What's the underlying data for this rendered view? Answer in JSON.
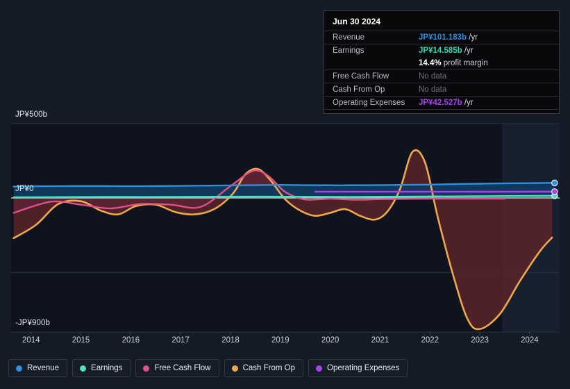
{
  "tooltip": {
    "date": "Jun 30 2024",
    "rows": [
      {
        "key": "Revenue",
        "amount": "JP¥101.183b",
        "unit": "/yr",
        "color": "#2d8fe0",
        "nodata": false
      },
      {
        "key": "Earnings",
        "amount": "JP¥14.585b",
        "unit": "/yr",
        "color": "#2fd6ae",
        "nodata": false
      },
      {
        "key": "",
        "amount": "14.4%",
        "unit": "profit margin",
        "color": "#ffffff",
        "nodata": false,
        "sub": true
      },
      {
        "key": "Free Cash Flow",
        "amount": "No data",
        "unit": "",
        "color": "#6e727a",
        "nodata": true
      },
      {
        "key": "Cash From Op",
        "amount": "No data",
        "unit": "",
        "color": "#6e727a",
        "nodata": true
      },
      {
        "key": "Operating Expenses",
        "amount": "JP¥42.527b",
        "unit": "/yr",
        "color": "#a93ff0",
        "nodata": false
      }
    ]
  },
  "legend": {
    "items": [
      {
        "label": "Revenue",
        "color": "#2d8fe0"
      },
      {
        "label": "Earnings",
        "color": "#4fe0c0"
      },
      {
        "label": "Free Cash Flow",
        "color": "#e0508a"
      },
      {
        "label": "Cash From Op",
        "color": "#eda94e"
      },
      {
        "label": "Operating Expenses",
        "color": "#a93ff0"
      }
    ]
  },
  "chart_data": {
    "type": "line",
    "title": "",
    "xlabel": "",
    "ylabel": "",
    "grid": true,
    "legend_position": "bottom",
    "currency": "JP¥",
    "unit": "b",
    "xlim": [
      2013.6,
      2024.6
    ],
    "ylim": [
      -900,
      500
    ],
    "y_ticks": [
      500,
      0,
      -900
    ],
    "y_tick_labels": [
      "JP¥500b",
      "JP¥0",
      "-JP¥900b"
    ],
    "x_ticks": [
      2014,
      2015,
      2016,
      2017,
      2018,
      2019,
      2020,
      2021,
      2022,
      2023,
      2024
    ],
    "x_tick_labels": [
      "2014",
      "2015",
      "2016",
      "2017",
      "2018",
      "2019",
      "2020",
      "2021",
      "2022",
      "2023",
      "2024"
    ],
    "forecast_start": 2023.45,
    "series": [
      {
        "name": "Revenue",
        "color": "#2d8fe0",
        "fill": "#113a5e",
        "end_marker": true,
        "x": [
          2013.65,
          2014.2,
          2014.8,
          2015.4,
          2016.0,
          2016.6,
          2017.2,
          2017.8,
          2018.4,
          2019.0,
          2019.6,
          2020.2,
          2020.8,
          2021.4,
          2022.0,
          2022.6,
          2023.2,
          2023.8,
          2024.5
        ],
        "y": [
          77,
          79,
          80,
          80,
          79,
          80,
          82,
          84,
          86,
          88,
          86,
          85,
          86,
          88,
          90,
          94,
          97,
          99,
          101.183
        ]
      },
      {
        "name": "Earnings",
        "color": "#4fe0c0",
        "fill": "#14463f",
        "end_marker": true,
        "x": [
          2013.65,
          2014.5,
          2015.5,
          2016.5,
          2017.5,
          2018.5,
          2019.5,
          2020.5,
          2021.5,
          2022.5,
          2023.5,
          2024.5
        ],
        "y": [
          5,
          6,
          7,
          7,
          8,
          9,
          8,
          7,
          9,
          11,
          13,
          14.585
        ]
      },
      {
        "name": "Free Cash Flow",
        "color": "#e0508a",
        "fill": "#5c2233",
        "end_marker": false,
        "x": [
          2013.65,
          2014.4,
          2015.0,
          2015.6,
          2016.2,
          2016.8,
          2017.4,
          2018.0,
          2018.45,
          2018.75,
          2019.1,
          2019.5,
          2020.0,
          2020.5,
          2021.0,
          2021.5,
          2022.0,
          2022.5,
          2023.0,
          2023.5
        ],
        "y": [
          -100,
          -25,
          -45,
          -70,
          -40,
          -45,
          -60,
          80,
          182,
          150,
          40,
          -10,
          -5,
          -12,
          -8,
          -6,
          -5,
          -5,
          -5,
          -5
        ]
      },
      {
        "name": "Cash From Op",
        "color": "#eda94e",
        "fill": "#5c2428",
        "end_marker": false,
        "x": [
          2013.65,
          2014.1,
          2014.55,
          2015.0,
          2015.4,
          2015.75,
          2016.1,
          2016.5,
          2016.9,
          2017.3,
          2017.7,
          2018.05,
          2018.3,
          2018.55,
          2018.8,
          2019.1,
          2019.4,
          2019.7,
          2020.0,
          2020.3,
          2020.6,
          2020.9,
          2021.15,
          2021.4,
          2021.65,
          2021.9,
          2022.15,
          2022.45,
          2022.75,
          2023.0,
          2023.4,
          2023.8,
          2024.2,
          2024.45
        ],
        "y": [
          -270,
          -180,
          -40,
          -22,
          -85,
          -110,
          -55,
          -45,
          -95,
          -110,
          -70,
          30,
          160,
          195,
          120,
          -10,
          -85,
          -120,
          -100,
          -75,
          -120,
          -145,
          -90,
          60,
          310,
          240,
          -120,
          -500,
          -810,
          -880,
          -780,
          -560,
          -360,
          -265
        ]
      },
      {
        "name": "Operating Expenses",
        "color": "#a93ff0",
        "fill": "none",
        "end_marker": true,
        "x": [
          2019.7,
          2020.4,
          2021.2,
          2022.0,
          2022.8,
          2023.6,
          2024.5
        ],
        "y": [
          42,
          42,
          42,
          42,
          42,
          42,
          42.527
        ]
      }
    ]
  },
  "colors": {
    "background": "#151b26",
    "plot_background": "#0e131d",
    "forecast_band": "#16202e",
    "gridline": "#2a3242",
    "zero_line": "#c9d2dd"
  }
}
